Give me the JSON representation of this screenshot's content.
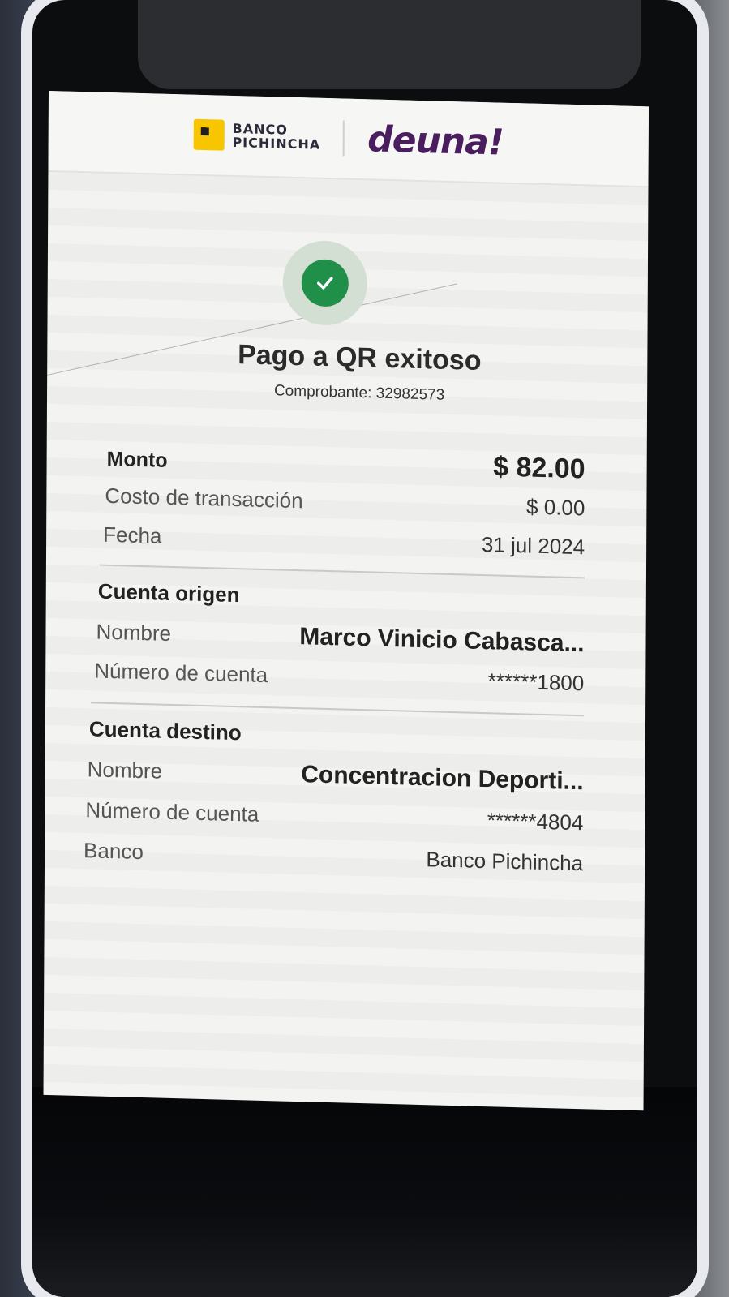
{
  "header": {
    "bank_logo_line1": "BANCO",
    "bank_logo_line2": "PICHINCHA",
    "app_logo": "deuna!"
  },
  "status": {
    "title": "Pago a QR exitoso",
    "receipt": "Comprobante: 32982573",
    "icon": "check-circle-icon",
    "color": "#1f8f4a"
  },
  "summary": {
    "amount_label": "Monto",
    "amount_value": "$ 82.00",
    "fee_label": "Costo de transacción",
    "fee_value": "$ 0.00",
    "date_label": "Fecha",
    "date_value": "31 jul 2024"
  },
  "origin": {
    "section_title": "Cuenta origen",
    "name_label": "Nombre",
    "name_value": "Marco Vinicio Cabasca...",
    "account_label": "Número de cuenta",
    "account_value": "******1800"
  },
  "destination": {
    "section_title": "Cuenta destino",
    "name_label": "Nombre",
    "name_value": "Concentracion Deporti...",
    "account_label": "Número de cuenta",
    "account_value": "******4804",
    "bank_label": "Banco",
    "bank_value": "Banco Pichincha"
  },
  "colors": {
    "brand_yellow": "#f7c600",
    "brand_purple": "#4a1e5e",
    "success_green": "#1f8f4a"
  }
}
